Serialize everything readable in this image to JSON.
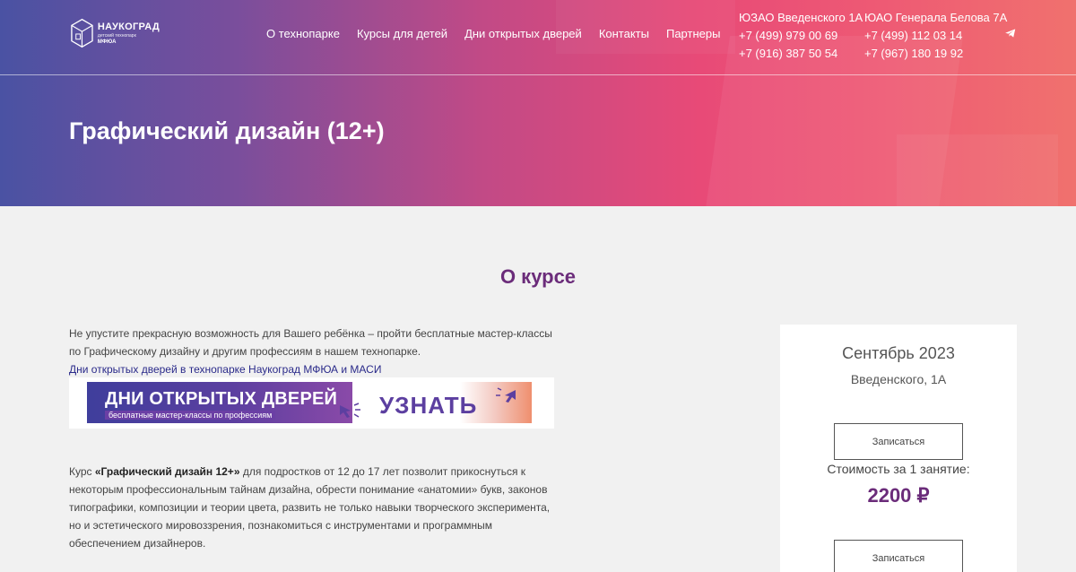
{
  "header": {
    "logo": {
      "name": "НАУКОГРАД",
      "subtitle": "детский технопарк",
      "org": "МФЮА"
    },
    "nav": [
      {
        "label": "О технопарке"
      },
      {
        "label": "Курсы для детей"
      },
      {
        "label": "Дни открытых дверей"
      },
      {
        "label": "Контакты"
      },
      {
        "label": "Партнеры"
      }
    ],
    "contacts": [
      {
        "address": "ЮЗАО Введенского 1А",
        "phone1": "+7 (499) 979 00 69",
        "phone2": "+7 (916) 387 50 54"
      },
      {
        "address": "ЮАО Генерала Белова 7А",
        "phone1": "+7 (499) 112 03 14",
        "phone2": "+7 (967) 180 19 92"
      }
    ],
    "telegram_icon": "telegram-icon"
  },
  "hero": {
    "title": "Графический дизайн (12+)"
  },
  "about": {
    "title": "О курсе",
    "intro": "Не упустите прекрасную возможность для Вашего ребёнка – пройти бесплатные мастер-классы по Графическому дизайну и другим профессиям в нашем технопарке.",
    "open_days_link": "Дни открытых дверей в технопарке Наукоград МФЮА и МАСИ",
    "banner": {
      "title": "ДНИ ОТКРЫТЫХ ДВЕРЕЙ",
      "subtitle": "бесплатные мастер-классы по профессиям",
      "cta": "УЗНАТЬ"
    },
    "course_prefix": "Курс ",
    "course_name": "«Графический дизайн 12+»",
    "course_text": " для подростков от 12 до 17 лет позволит прикоснуться к некоторым профессиональным тайнам дизайна, обрести понимание «анатомии» букв, законов типографики, композиции и теории цвета, развить не только навыки творческого эксперимента, но и эстетического мировоззрения, познакомиться с инструментами и программным обеспечением дизайнеров."
  },
  "card": {
    "date": "Сентябрь 2023",
    "place": "Введенского, 1А",
    "signup_label": "Записаться",
    "cost_label": "Стоимость за 1 занятие:",
    "price": "2200 ₽",
    "signup_label_2": "Записаться"
  },
  "colors": {
    "accent": "#6b2c7a",
    "link": "#2a2a8a",
    "banner_purple": "#5c3fa0"
  }
}
